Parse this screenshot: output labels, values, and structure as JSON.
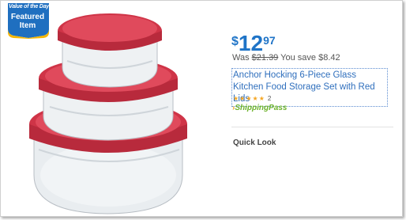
{
  "badge": {
    "line1": "Value of the Day",
    "line2": "Featured",
    "line3": "Item"
  },
  "price": {
    "currency": "$",
    "dollars": "12",
    "cents": "97"
  },
  "savings": {
    "was_label": "Was",
    "was_price": "$21.39",
    "save_text": "You save $8.42"
  },
  "product": {
    "title": "Anchor Hocking 6-Piece Glass Kitchen Food Storage Set with Red Lids",
    "rating_stars": "★★★★★",
    "rating": 5,
    "review_count": "2",
    "shipping_icon": "›",
    "shipping_label": "ShippingPass"
  },
  "actions": {
    "quick_look": "Quick Look"
  },
  "colors": {
    "price_blue": "#1f74c7",
    "lid_red": "#d8394a",
    "badge_blue": "#1f6fc0",
    "badge_yellow": "#f7b600",
    "shipping_green": "#6eb32c"
  }
}
